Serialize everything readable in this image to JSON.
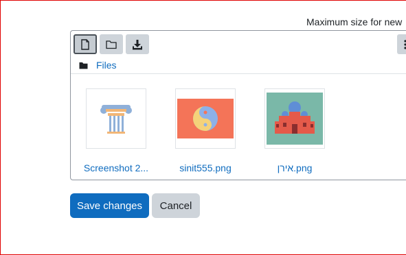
{
  "max_size_text": "Maximum size for new",
  "toolbar": {
    "buttons": [
      {
        "icon": "file-icon"
      },
      {
        "icon": "folder-icon"
      },
      {
        "icon": "download-icon"
      }
    ],
    "more_icon": "more-vertical-icon"
  },
  "breadcrumb": {
    "icon": "folder-icon",
    "label": "Files"
  },
  "files": [
    {
      "name": "Screenshot 2...",
      "thumb": "column-icon"
    },
    {
      "name": "sinit555.png",
      "thumb": "yin-yang-icon"
    },
    {
      "name": "אירן.png",
      "thumb": "building-icon"
    }
  ],
  "actions": {
    "save_label": "Save changes",
    "cancel_label": "Cancel"
  },
  "colors": {
    "link": "#0f6cbf",
    "primary_button": "#0f6cbf",
    "secondary_button": "#ced4da",
    "border": "#8f959e"
  }
}
